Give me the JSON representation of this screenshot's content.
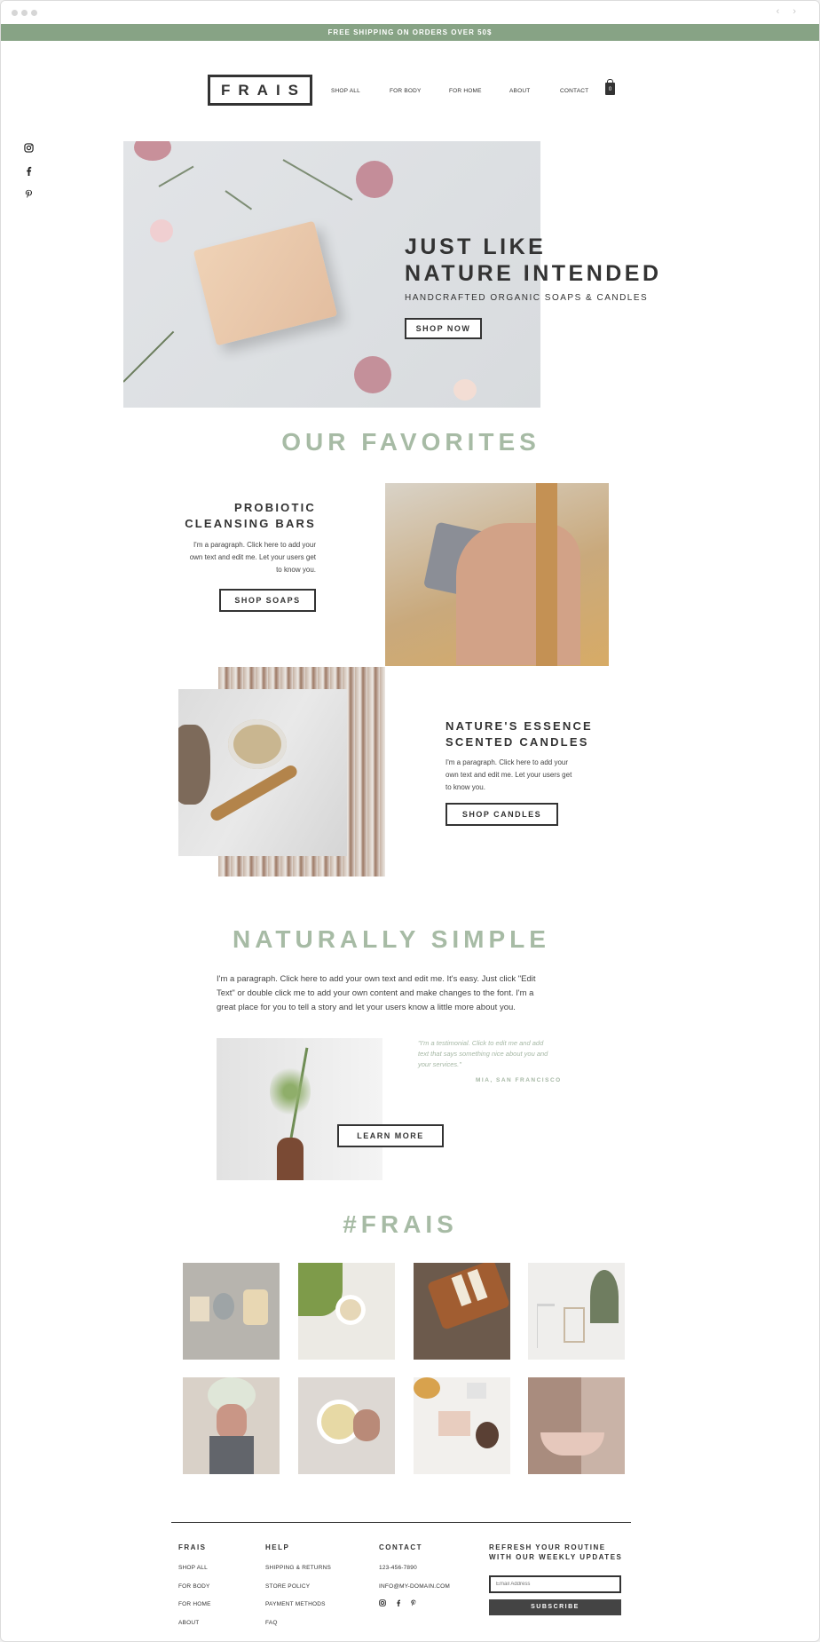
{
  "announcement": "FREE SHIPPING ON ORDERS OVER 50$",
  "header": {
    "logo": "FRAIS",
    "nav": [
      "SHOP ALL",
      "FOR BODY",
      "FOR HOME",
      "ABOUT",
      "CONTACT"
    ],
    "cart_count": "0"
  },
  "social_icons": [
    "instagram-icon",
    "facebook-icon",
    "pinterest-icon"
  ],
  "hero": {
    "title_line1": "JUST LIKE",
    "title_line2": "NATURE INTENDED",
    "subtitle": "HANDCRAFTED ORGANIC SOAPS & CANDLES",
    "button": "SHOP NOW"
  },
  "favorites": {
    "title": "OUR FAVORITES",
    "soaps": {
      "title_line1": "PROBIOTIC",
      "title_line2": "CLEANSING BARS",
      "para_line1": "I'm a paragraph. Click here to add your",
      "para_line2": "own text and edit me. Let your users get",
      "para_line3": "to know you.",
      "button": "SHOP SOAPS"
    },
    "candles": {
      "title_line1": "NATURE'S ESSENCE",
      "title_line2": "SCENTED CANDLES",
      "para_line1": "I'm a paragraph. Click here to add your",
      "para_line2": "own text and edit me. Let your users get",
      "para_line3": "to know you.",
      "button": "SHOP CANDLES"
    }
  },
  "simple": {
    "title": "NATURALLY SIMPLE",
    "para_line1": "I'm a paragraph. Click here to add your own text and edit me. It's easy. Just click \"Edit",
    "para_line2": "Text\" or double click me to add your own content and make changes to the font. I'm a",
    "para_line3": "great place for you to tell a story and let your users know a little more about you.",
    "testimonial_line1": "\"I'm a testimonial. Click to edit me and add",
    "testimonial_line2": "text that says something nice about you and",
    "testimonial_line3": "your services.\"",
    "testimonial_author": "MIA, SAN FRANCISCO",
    "button": "LEARN MORE"
  },
  "gallery": {
    "title": "#FRAIS"
  },
  "footer": {
    "col1_head": "FRAIS",
    "col1_links": [
      "SHOP ALL",
      "FOR BODY",
      "FOR HOME",
      "ABOUT"
    ],
    "col2_head": "HELP",
    "col2_links": [
      "SHIPPING & RETURNS",
      "STORE POLICY",
      "PAYMENT METHODS",
      "FAQ"
    ],
    "col3_head": "CONTACT",
    "phone": "123-456-7890",
    "email": "INFO@MY-DOMAIN.COM",
    "col4_head_line1": "REFRESH YOUR ROUTINE",
    "col4_head_line2": "WITH OUR WEEKLY UPDATES",
    "email_placeholder": "Email Address",
    "subscribe": "SUBSCRIBE"
  },
  "colors": {
    "accent": "#87a385",
    "heading_green": "#a7bba5",
    "text": "#333333"
  }
}
